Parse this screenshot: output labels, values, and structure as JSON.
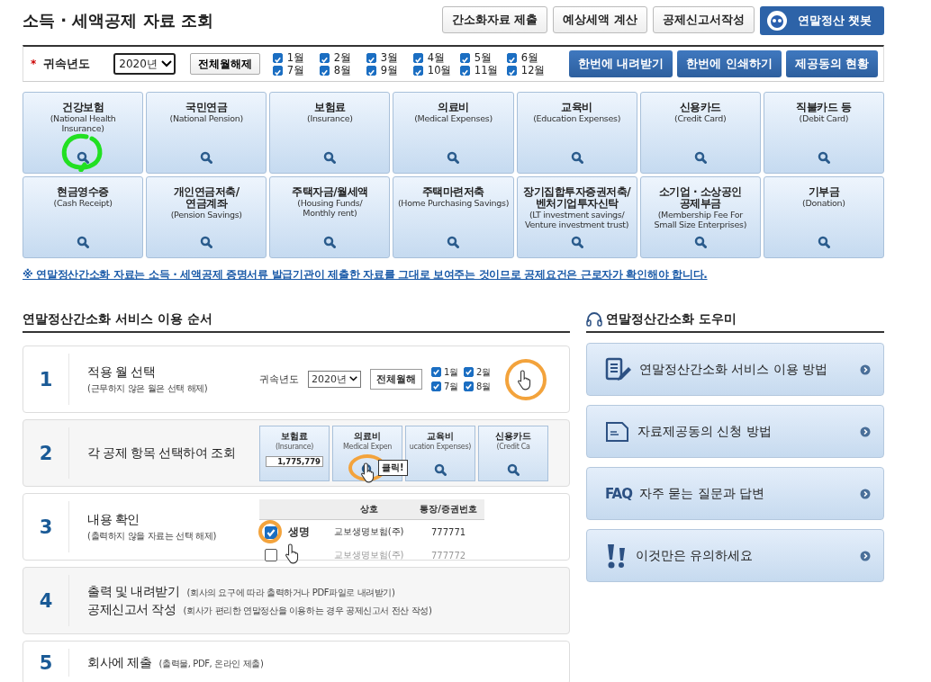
{
  "page_title": "소득 · 세액공제 자료 조회",
  "header_buttons": [
    "간소화자료 제출",
    "예상세액 계산",
    "공제신고서작성"
  ],
  "chatbot_button": "연말정산 챗봇",
  "filter": {
    "required_mark": "*",
    "label": "귀속년도",
    "year": "2020년",
    "clear_button": "전체월해제",
    "months": [
      {
        "label": "1월",
        "checked": true
      },
      {
        "label": "2월",
        "checked": true
      },
      {
        "label": "3월",
        "checked": true
      },
      {
        "label": "4월",
        "checked": true
      },
      {
        "label": "5월",
        "checked": true
      },
      {
        "label": "6월",
        "checked": true
      },
      {
        "label": "7월",
        "checked": true
      },
      {
        "label": "8월",
        "checked": true
      },
      {
        "label": "9월",
        "checked": true
      },
      {
        "label": "10월",
        "checked": true
      },
      {
        "label": "11월",
        "checked": true
      },
      {
        "label": "12월",
        "checked": true
      }
    ],
    "actions": [
      "한번에 내려받기",
      "한번에 인쇄하기",
      "제공동의 현황"
    ]
  },
  "categories": [
    {
      "title": [
        "건강보험"
      ],
      "subtitle": [
        "(National Health",
        "Insurance)"
      ]
    },
    {
      "title": [
        "국민연금"
      ],
      "subtitle": [
        "(National Pension)"
      ]
    },
    {
      "title": [
        "보험료"
      ],
      "subtitle": [
        "(Insurance)"
      ]
    },
    {
      "title": [
        "의료비"
      ],
      "subtitle": [
        "(Medical Expenses)"
      ]
    },
    {
      "title": [
        "교육비"
      ],
      "subtitle": [
        "(Education Expenses)"
      ]
    },
    {
      "title": [
        "신용카드"
      ],
      "subtitle": [
        "(Credit Card)"
      ]
    },
    {
      "title": [
        "직불카드 등"
      ],
      "subtitle": [
        "(Debit Card)"
      ]
    },
    {
      "title": [
        "현금영수증"
      ],
      "subtitle": [
        "(Cash Receipt)"
      ]
    },
    {
      "title": [
        "개인연금저축/",
        "연금계좌"
      ],
      "subtitle": [
        "(Pension Savings)"
      ]
    },
    {
      "title": [
        "주택자금/월세액"
      ],
      "subtitle": [
        "(Housing Funds/",
        "Monthly rent)"
      ]
    },
    {
      "title": [
        "주택마련저축"
      ],
      "subtitle": [
        "(Home Purchasing Savings)"
      ]
    },
    {
      "title": [
        "장기집합투자증권저축/",
        "벤처기업투자신탁"
      ],
      "subtitle": [
        "(LT investment savings/",
        "Venture investment trust)"
      ]
    },
    {
      "title": [
        "소기업 · 소상공인",
        "공제부금"
      ],
      "subtitle": [
        "(Membership Fee For",
        "Small Size Enterprises)"
      ]
    },
    {
      "title": [
        "기부금"
      ],
      "subtitle": [
        "(Donation)"
      ]
    }
  ],
  "notice": "※ 연말정산간소화 자료는 소득 · 세액공제 증명서류 발급기관이 제출한 자료를 그대로 보여주는 것이므로 공제요건은 근로자가 확인해야 합니다.",
  "steps_section": {
    "title": "연말정산간소화 서비스 이용 순서",
    "steps": [
      {
        "number": "1",
        "lines": [
          {
            "title": "적용 월 선택",
            "note": "(근무하지 않은 월은 선택 해제)"
          }
        ],
        "illustration": {
          "kind": "month-select",
          "label": "귀속년도",
          "year": "2020년",
          "button": "전체월해",
          "months": [
            {
              "label": "1월",
              "checked": true
            },
            {
              "label": "2월",
              "checked": true
            },
            {
              "label": "7월",
              "checked": true
            },
            {
              "label": "8월",
              "checked": true
            }
          ]
        }
      },
      {
        "number": "2",
        "lines": [
          {
            "title": "각 공제 항목 선택하여 조회"
          }
        ],
        "illustration": {
          "kind": "category-select",
          "tooltip": "클릭!",
          "cards": [
            {
              "title": "보험료",
              "subtitle": "(Insurance)",
              "amount": "1,775,779"
            },
            {
              "title": "의료비",
              "subtitle": "Medical Expen"
            },
            {
              "title": "교육비",
              "subtitle": "ucation Expenses)"
            },
            {
              "title": "신용카드",
              "subtitle": "(Credit Ca"
            }
          ]
        }
      },
      {
        "number": "3",
        "lines": [
          {
            "title": "내용 확인",
            "note": "(출력하지 않을 자료는 선택 해제)"
          }
        ],
        "illustration": {
          "kind": "row-select",
          "headers": [
            "상호",
            "통장/증권번호"
          ],
          "magnified": "생명",
          "rows": [
            {
              "company": "교보생명보험(주)",
              "account": "777771",
              "checked": true
            },
            {
              "company": "교보생명보험(주)",
              "account": "777772",
              "checked": false
            }
          ]
        }
      },
      {
        "number": "4",
        "lines": [
          {
            "title": "출력 및 내려받기",
            "note": "(회사의 요구에 따라 출력하거나 PDF파일로 내려받기)"
          },
          {
            "title": "공제신고서 작성",
            "note": "(회사가 편리한 연말정산을 이용하는 경우 공제신고서 전산 작성)"
          }
        ]
      },
      {
        "number": "5",
        "lines": [
          {
            "title": "회사에 제출",
            "note": "(출력물, PDF, 온라인 제출)"
          }
        ]
      }
    ]
  },
  "helper": {
    "title": "연말정산간소화 도우미",
    "items": [
      {
        "kind": "guide",
        "label": "연말정산간소화 서비스 이용 방법"
      },
      {
        "kind": "document",
        "label": "자료제공동의 신청 방법"
      },
      {
        "kind": "faq",
        "icon_text": "FAQ",
        "label": "자주 묻는 질문과 답변"
      },
      {
        "kind": "warning",
        "label": "이것만은 유의하세요"
      }
    ]
  }
}
